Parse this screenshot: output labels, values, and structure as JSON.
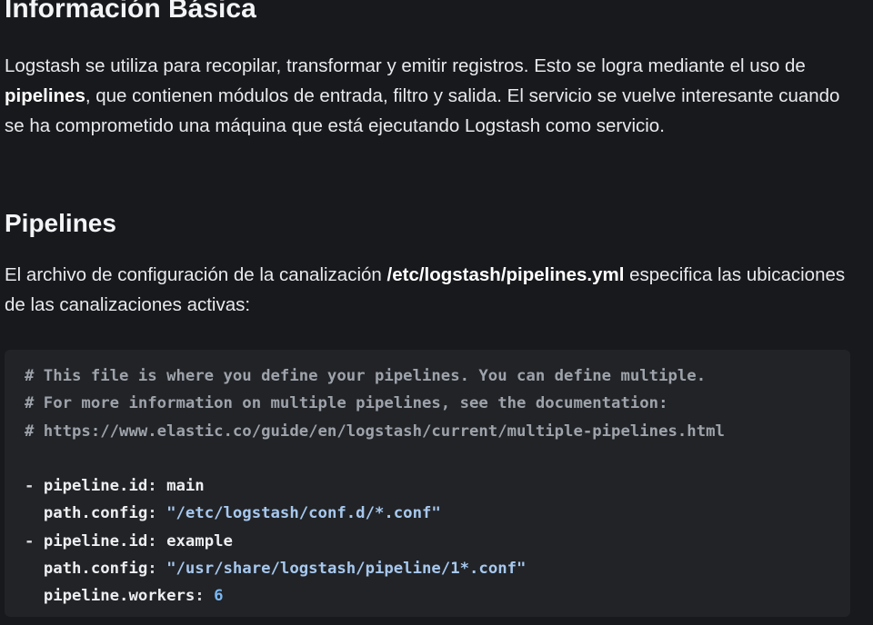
{
  "heading_basic": "Información Básica",
  "para1": {
    "text_a": "Logstash se utiliza para recopilar, transformar y emitir registros. Esto se logra mediante el uso de ",
    "bold": "pipelines",
    "text_b": ", que contienen módulos de entrada, filtro y salida. El servicio se vuelve interesante cuando se ha comprometido una máquina que está ejecutando Logstash como servicio."
  },
  "heading_pipelines": "Pipelines",
  "para2": {
    "text_a": "El archivo de configuración de la canalización ",
    "bold": "/etc/logstash/pipelines.yml",
    "text_b": " especifica las ubicaciones de las canalizaciones activas:"
  },
  "code": {
    "comment1": "# This file is where you define your pipelines. You can define multiple.",
    "comment2": "# For more information on multiple pipelines, see the documentation:",
    "comment3": "# https://www.elastic.co/guide/en/logstash/current/multiple-pipelines.html",
    "dash": "- ",
    "indent": "  ",
    "key_pipeline_id": "pipeline.id",
    "colon": ": ",
    "val_main": "main",
    "key_path_config": "path.config",
    "val_path1": "\"/etc/logstash/conf.d/*.conf\"",
    "val_example": "example",
    "val_path2": "\"/usr/share/logstash/pipeline/1*.conf\"",
    "key_workers": "pipeline.workers",
    "val_workers": "6"
  }
}
